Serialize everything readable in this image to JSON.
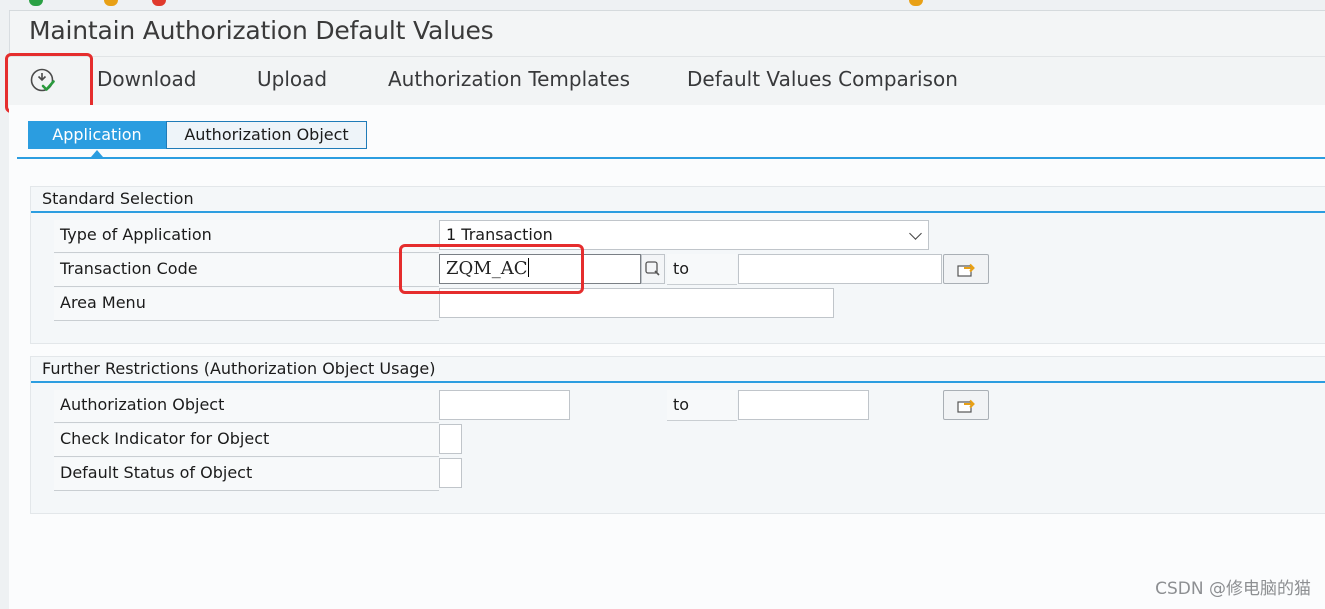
{
  "window": {
    "title": "Maintain Authorization Default Values"
  },
  "toolbar": {
    "execute_icon": "execute-icon",
    "items": [
      {
        "label": "Download"
      },
      {
        "label": "Upload"
      },
      {
        "label": "Authorization Templates"
      },
      {
        "label": "Default Values Comparison"
      }
    ]
  },
  "tabs": [
    {
      "label": "Application",
      "active": true
    },
    {
      "label": "Authorization Object",
      "active": false
    }
  ],
  "standard_selection": {
    "title": "Standard Selection",
    "type_of_application": {
      "label": "Type of Application",
      "value": "1 Transaction"
    },
    "transaction_code": {
      "label": "Transaction Code",
      "value": "ZQM_AC",
      "to_label": "to",
      "to_value": ""
    },
    "area_menu": {
      "label": "Area Menu",
      "value": ""
    }
  },
  "further_restrictions": {
    "title": "Further Restrictions (Authorization Object Usage)",
    "authorization_object": {
      "label": "Authorization Object",
      "value": "",
      "to_label": "to",
      "to_value": ""
    },
    "check_indicator": {
      "label": "Check Indicator for Object",
      "value": ""
    },
    "default_status": {
      "label": "Default Status of Object",
      "value": ""
    }
  },
  "watermark": "CSDN @修电脑的猫",
  "colors": {
    "accent": "#2b9de0",
    "highlight": "#e52d2d",
    "execute_green": "#2a9a3d"
  }
}
